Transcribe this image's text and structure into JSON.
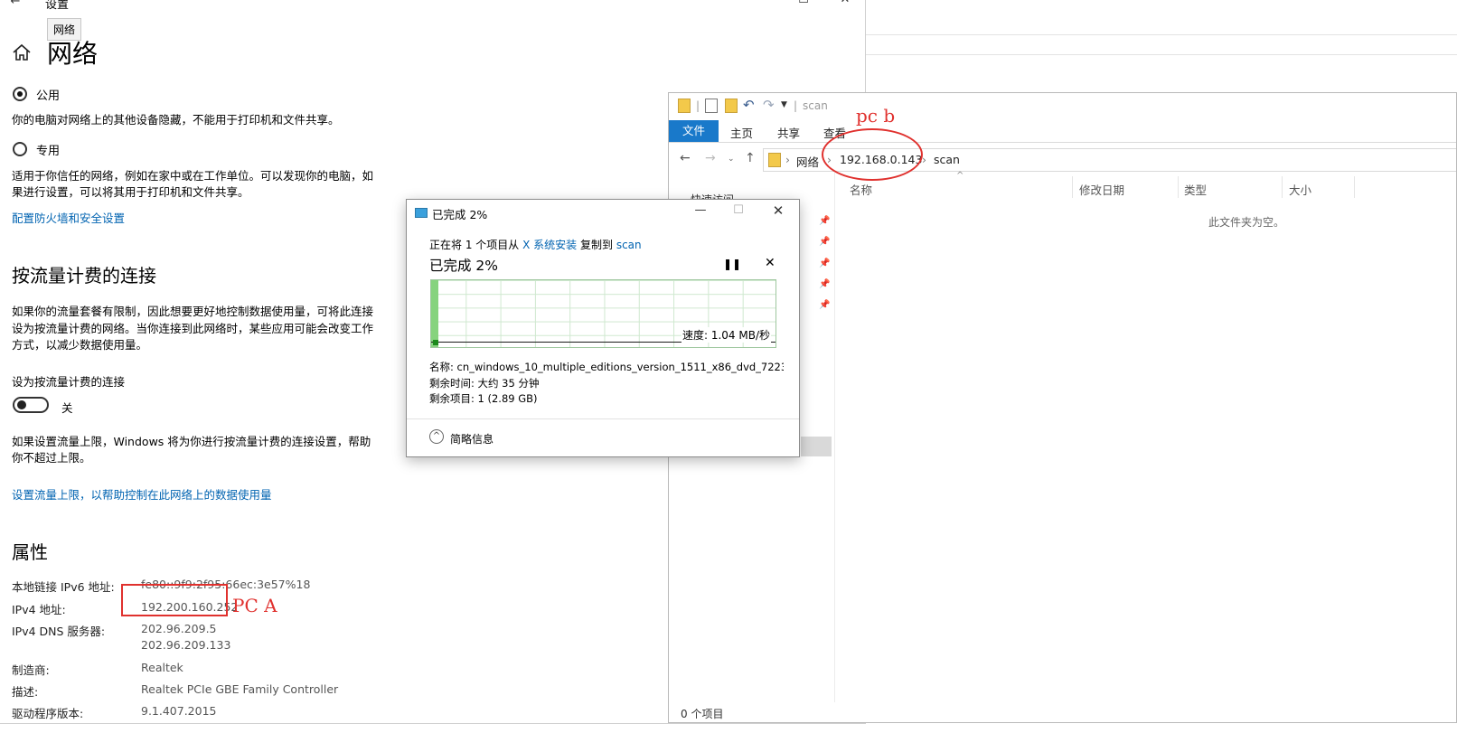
{
  "settings": {
    "window_title": "设置",
    "tooltip": "网络",
    "page_title": "网络",
    "public_label": "公用",
    "public_desc": "你的电脑对网络上的其他设备隐藏，不能用于打印机和文件共享。",
    "private_label": "专用",
    "private_desc_1": "适用于你信任的网络，例如在家中或在工作单位。可以发现你的电脑，如",
    "private_desc_2": "果进行设置，可以将其用于打印机和文件共享。",
    "firewall_link": "配置防火墙和安全设置",
    "metered_heading": "按流量计费的连接",
    "metered_desc_1": "如果你的流量套餐有限制，因此想要更好地控制数据使用量，可将此连接",
    "metered_desc_2": "设为按流量计费的网络。当你连接到此网络时，某些应用可能会改变工作",
    "metered_desc_3": "方式，以减少数据使用量。",
    "metered_toggle_label": "设为按流量计费的连接",
    "metered_toggle_state": "关",
    "limit_desc_1": "如果设置流量上限，Windows 将为你进行按流量计费的连接设置，帮助",
    "limit_desc_2": "你不超过上限。",
    "limit_link": "设置流量上限，以帮助控制在此网络上的数据使用量",
    "props_heading": "属性",
    "properties": [
      {
        "label": "本地链接 IPv6 地址:",
        "value": "fe80::9f9:2f95:66ec:3e57%18"
      },
      {
        "label": "IPv4 地址:",
        "value": "192.200.160.252"
      },
      {
        "label": "IPv4 DNS 服务器:",
        "value": "202.96.209.5",
        "value2": "202.96.209.133"
      },
      {
        "label": "制造商:",
        "value": "Realtek"
      },
      {
        "label": "描述:",
        "value": "Realtek PCIe GBE Family Controller"
      },
      {
        "label": "驱动程序版本:",
        "value": "9.1.407.2015"
      }
    ]
  },
  "explorer": {
    "qat_title": "scan",
    "tabs": [
      "文件",
      "主页",
      "共享",
      "查看"
    ],
    "breadcrumb": [
      "网络",
      "192.168.0.143",
      "scan"
    ],
    "nav_partial": "快速访问",
    "columns": [
      "名称",
      "修改日期",
      "类型",
      "大小"
    ],
    "empty_message": "此文件夹为空。",
    "status": "0 个项目"
  },
  "progress": {
    "title": "已完成 2%",
    "copy_prefix": "正在将 1 个项目从",
    "copy_source": "X 系统安装",
    "copy_middle": "复制到",
    "copy_dest": "scan",
    "heading": "已完成 2%",
    "percent": 2,
    "speed": "速度: 1.04 MB/秒",
    "name_line": "名称: cn_windows_10_multiple_editions_version_1511_x86_dvd_7223...",
    "time_line": "剩余时间: 大约 35 分钟",
    "items_line": "剩余项目: 1 (2.89 GB)",
    "less_details": "简略信息"
  },
  "annotations": {
    "pc_a": "PC  A",
    "pc_b": "pc  b",
    "color": "#e0312e"
  }
}
